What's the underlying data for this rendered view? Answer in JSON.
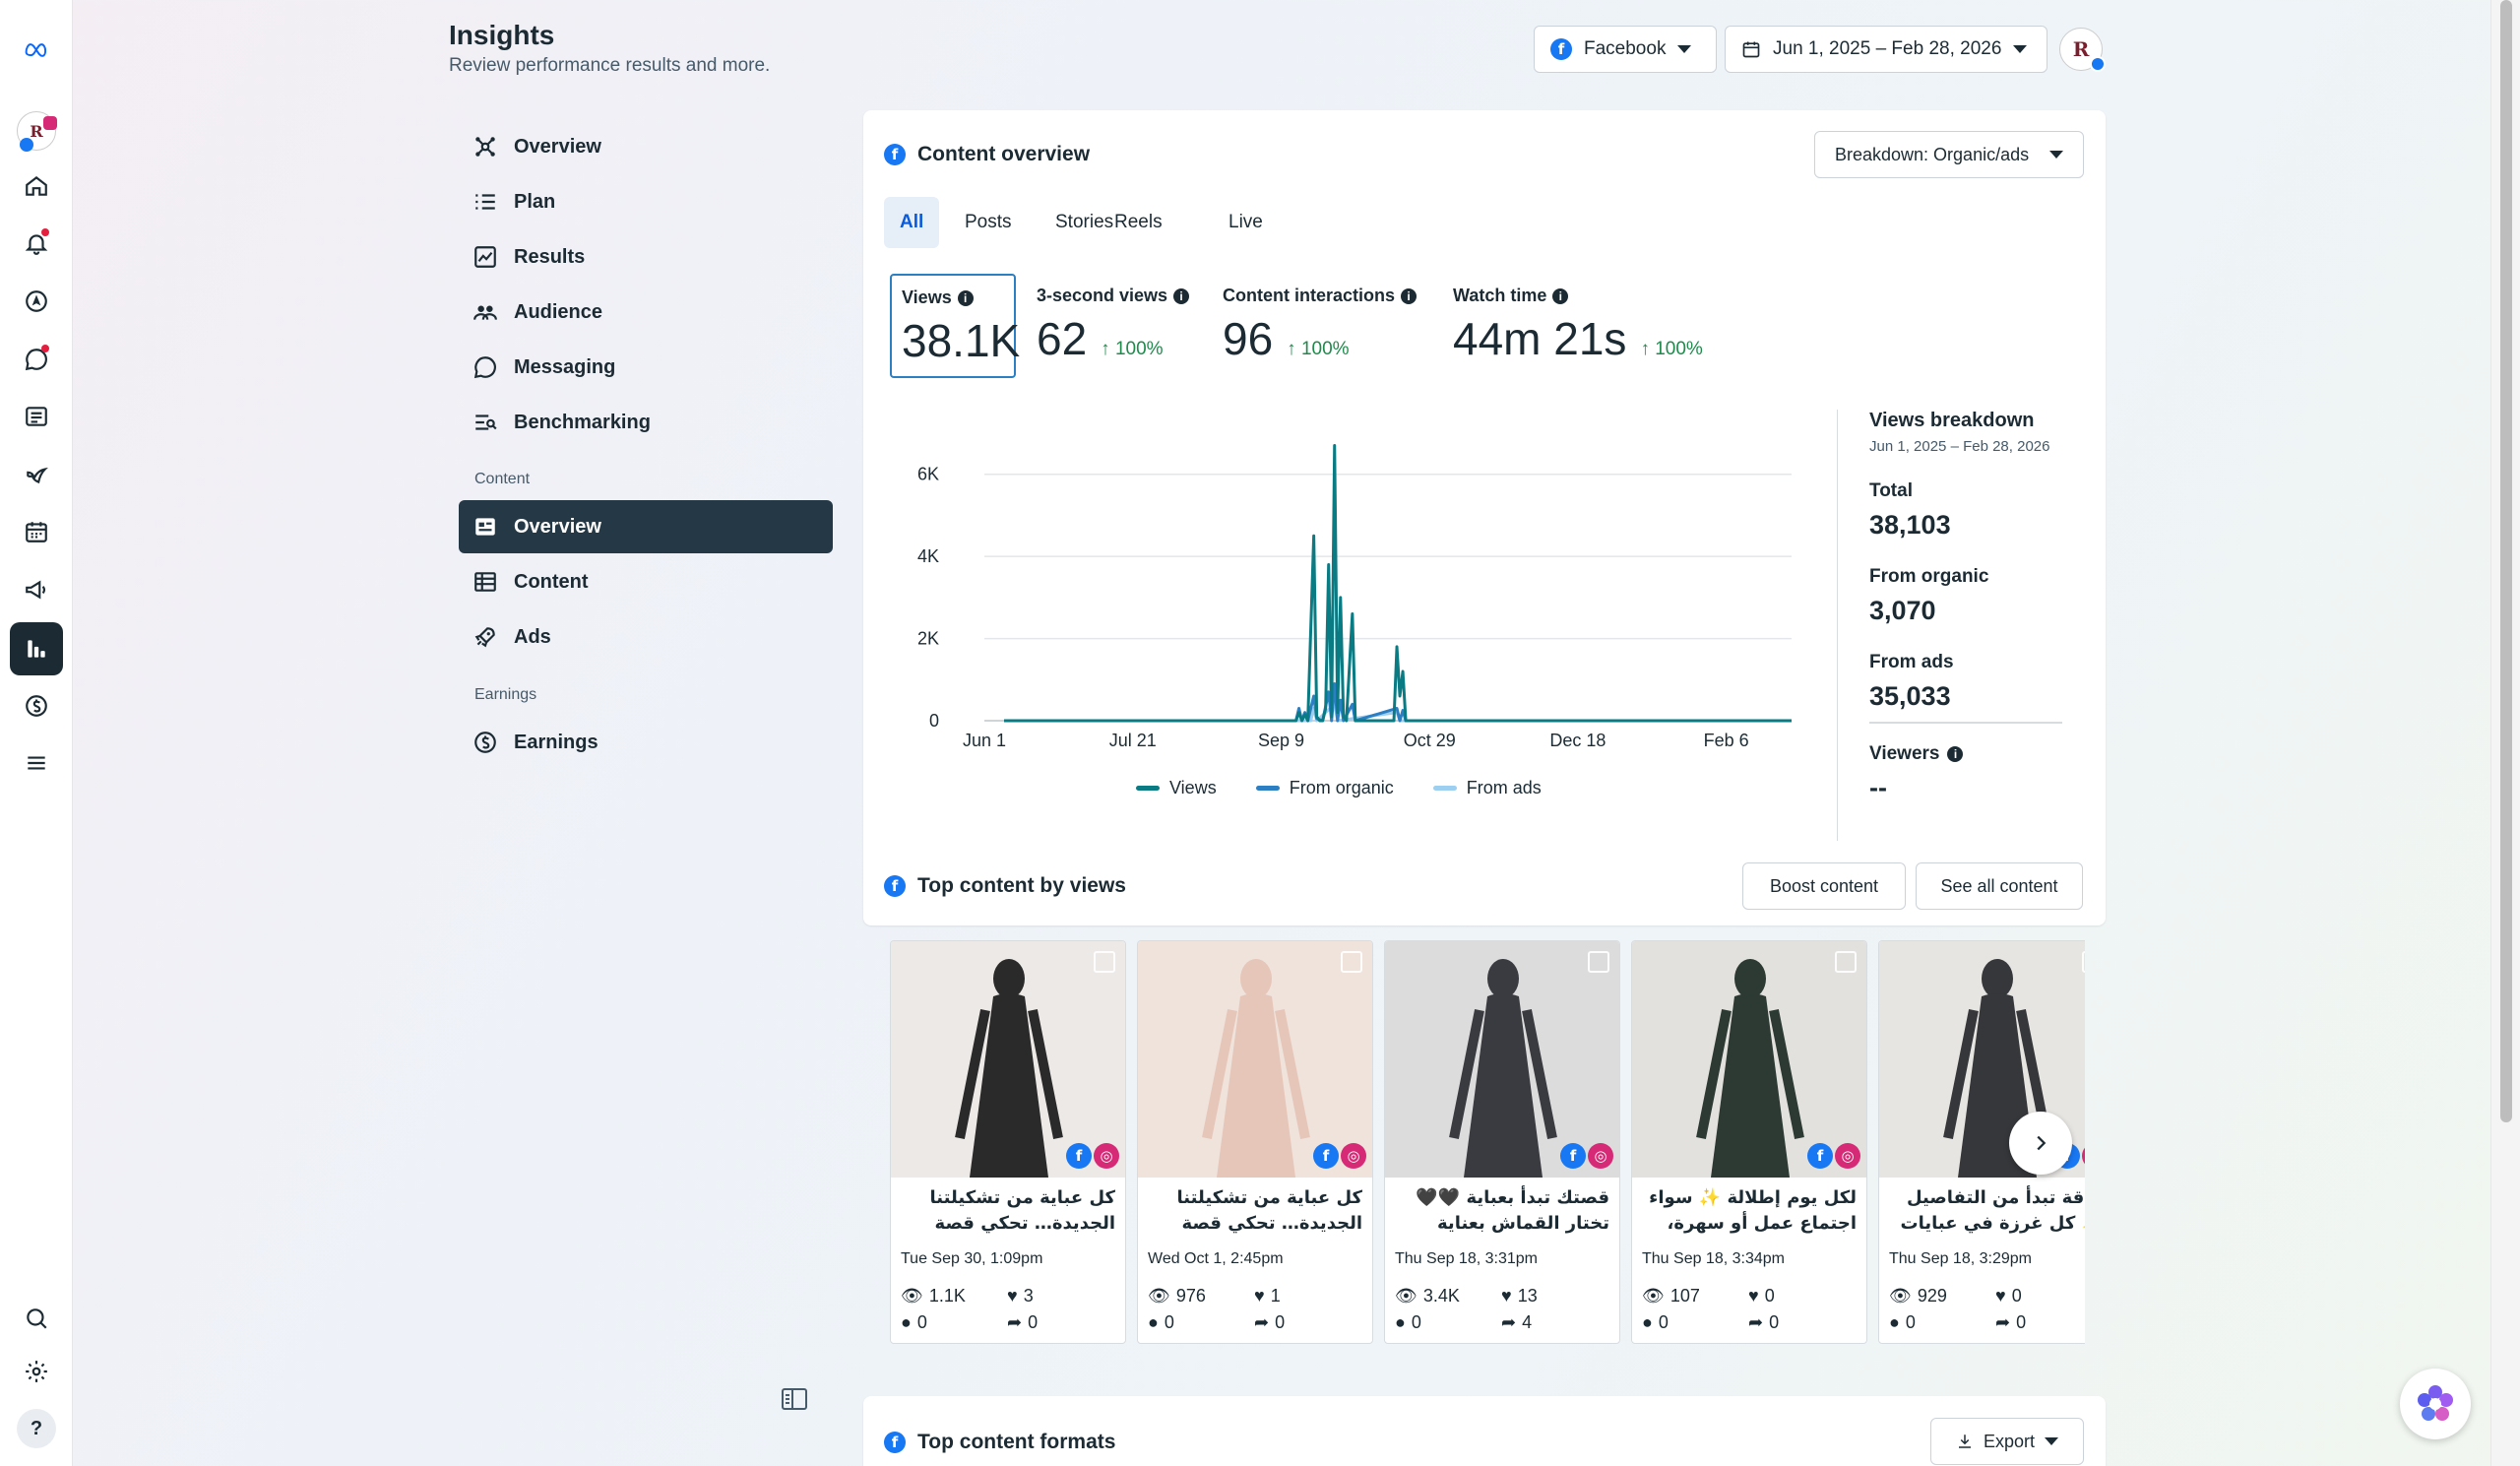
{
  "header": {
    "title": "Insights",
    "subtitle": "Review performance results and more.",
    "platform": "Facebook",
    "date_range": "Jun 1, 2025 – Feb 28, 2026",
    "avatar_initials": "R"
  },
  "rail": {
    "items": [
      "meta-logo",
      "profile",
      "home",
      "notifications",
      "navigate",
      "messages",
      "posts",
      "feed",
      "calendar",
      "ads",
      "insights",
      "monetization",
      "menu",
      "search",
      "settings",
      "help"
    ]
  },
  "nav": {
    "items": [
      {
        "label": "Overview",
        "icon": "overview-icon"
      },
      {
        "label": "Plan",
        "icon": "plan-icon"
      },
      {
        "label": "Results",
        "icon": "results-icon"
      },
      {
        "label": "Audience",
        "icon": "audience-icon"
      },
      {
        "label": "Messaging",
        "icon": "messaging-icon"
      },
      {
        "label": "Benchmarking",
        "icon": "benchmarking-icon"
      }
    ],
    "content_section": "Content",
    "content_items": [
      {
        "label": "Overview",
        "icon": "content-overview-icon"
      },
      {
        "label": "Content",
        "icon": "table-icon"
      },
      {
        "label": "Ads",
        "icon": "rocket-icon"
      }
    ],
    "earnings_section": "Earnings",
    "earnings_items": [
      {
        "label": "Earnings",
        "icon": "dollar-icon"
      }
    ]
  },
  "content_overview": {
    "title": "Content overview",
    "breakdown": "Breakdown: Organic/ads",
    "tabs": [
      "All",
      "Posts",
      "Stories",
      "Reels",
      "Live"
    ],
    "active_tab": "All",
    "metrics": [
      {
        "label": "Views",
        "value": "38.1K",
        "delta": ""
      },
      {
        "label": "3-second views",
        "value": "62",
        "delta": "100%"
      },
      {
        "label": "Content interactions",
        "value": "96",
        "delta": "100%"
      },
      {
        "label": "Watch time",
        "value": "44m 21s",
        "delta": "100%"
      }
    ],
    "breakdown_panel": {
      "title": "Views breakdown",
      "range": "Jun 1, 2025 – Feb 28, 2026",
      "total_label": "Total",
      "total_value": "38,103",
      "organic_label": "From organic",
      "organic_value": "3,070",
      "ads_label": "From ads",
      "ads_value": "35,033",
      "viewers_label": "Viewers",
      "viewers_value": "--"
    }
  },
  "chart_data": {
    "type": "line",
    "x_ticks": [
      "Jun 1",
      "Jul 21",
      "Sep 9",
      "Oct 29",
      "Dec 18",
      "Feb 6"
    ],
    "y_ticks": [
      "0",
      "2K",
      "4K",
      "6K"
    ],
    "ylim": [
      0,
      7000
    ],
    "x_range_days": [
      0,
      272
    ],
    "series": [
      {
        "name": "Views",
        "color": "#0a7a83",
        "points": [
          [
            0,
            0
          ],
          [
            105,
            0
          ],
          [
            106,
            200
          ],
          [
            107,
            0
          ],
          [
            108,
            150
          ],
          [
            109,
            0
          ],
          [
            111,
            4500
          ],
          [
            112,
            100
          ],
          [
            113,
            0
          ],
          [
            114,
            0
          ],
          [
            115,
            300
          ],
          [
            116,
            3800
          ],
          [
            117,
            100
          ],
          [
            118,
            6700
          ],
          [
            119,
            200
          ],
          [
            120,
            3000
          ],
          [
            121,
            100
          ],
          [
            122,
            0
          ],
          [
            124,
            2600
          ],
          [
            125,
            0
          ],
          [
            138,
            0
          ],
          [
            139,
            1800
          ],
          [
            140,
            600
          ],
          [
            141,
            1200
          ],
          [
            142,
            0
          ],
          [
            272,
            0
          ]
        ]
      },
      {
        "name": "From organic",
        "color": "#2d7fc4",
        "points": [
          [
            0,
            0
          ],
          [
            105,
            0
          ],
          [
            106,
            300
          ],
          [
            107,
            0
          ],
          [
            108,
            200
          ],
          [
            109,
            0
          ],
          [
            111,
            600
          ],
          [
            112,
            50
          ],
          [
            114,
            0
          ],
          [
            116,
            700
          ],
          [
            117,
            0
          ],
          [
            118,
            900
          ],
          [
            119,
            0
          ],
          [
            120,
            500
          ],
          [
            121,
            0
          ],
          [
            124,
            400
          ],
          [
            125,
            0
          ],
          [
            139,
            300
          ],
          [
            140,
            0
          ],
          [
            141,
            250
          ],
          [
            142,
            0
          ],
          [
            272,
            0
          ]
        ]
      },
      {
        "name": "From ads",
        "color": "#9ccff0",
        "points": [
          [
            0,
            0
          ],
          [
            110,
            0
          ],
          [
            111,
            300
          ],
          [
            112,
            0
          ],
          [
            118,
            400
          ],
          [
            119,
            0
          ],
          [
            139,
            200
          ],
          [
            140,
            0
          ],
          [
            272,
            0
          ]
        ]
      }
    ]
  },
  "top_content": {
    "title": "Top content by views",
    "boost_label": "Boost content",
    "see_all_label": "See all content",
    "items": [
      {
        "caption": "كل عباية من تشكيلتنا الجديدة… تحكي قصة",
        "date": "Tue Sep 30, 1:09pm",
        "views": "1.1K",
        "likes": "3",
        "comments": "0",
        "shares": "0",
        "bg": "#ece9e6",
        "fg": "#2a2a2a"
      },
      {
        "caption": "كل عباية من تشكيلتنا الجديدة… تحكي قصة",
        "date": "Wed Oct 1, 2:45pm",
        "views": "976",
        "likes": "1",
        "comments": "0",
        "shares": "0",
        "bg": "#efe3dc",
        "fg": "#e6c6b8"
      },
      {
        "caption": "قصتك تبدأ بعباية 🖤🖤 تختار القماش بعناية ونطرز",
        "date": "Thu Sep 18, 3:31pm",
        "views": "3.4K",
        "likes": "13",
        "comments": "0",
        "shares": "4",
        "bg": "#dcdcdc",
        "fg": "#3a3b40"
      },
      {
        "caption": "لكل يوم إطلالة ✨ سواء اجتماع عمل أو سهرة،",
        "date": "Thu Sep 18, 3:34pm",
        "views": "107",
        "likes": "0",
        "comments": "0",
        "shares": "0",
        "bg": "#e3e1de",
        "fg": "#2c3a33"
      },
      {
        "caption": "أناقة تبدأ من التفاصيل ✨ كل غرزة في عبايات",
        "date": "Thu Sep 18, 3:29pm",
        "views": "929",
        "likes": "0",
        "comments": "0",
        "shares": "0",
        "bg": "#e7e5e2",
        "fg": "#35373a"
      }
    ]
  },
  "top_formats": {
    "title": "Top content formats",
    "export_label": "Export"
  }
}
